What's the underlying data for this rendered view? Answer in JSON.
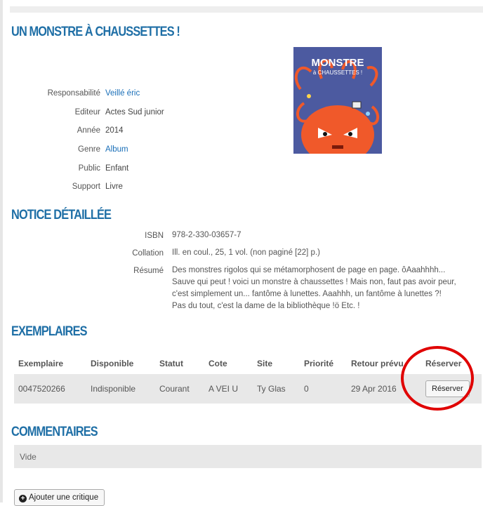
{
  "title": "UN MONSTRE À CHAUSSETTES !",
  "info": [
    {
      "label": "Responsabilité",
      "value": "Veillé éric",
      "link": true
    },
    {
      "label": "Editeur",
      "value": "Actes Sud junior",
      "link": false
    },
    {
      "label": "Année",
      "value": "2014",
      "link": false
    },
    {
      "label": "Genre",
      "value": "Album",
      "link": true
    },
    {
      "label": "Public",
      "value": "Enfant",
      "link": false
    },
    {
      "label": "Support",
      "value": "Livre",
      "link": false
    }
  ],
  "cover": {
    "line1": "MONSTRE",
    "line2": "à CHAUSSETTES !",
    "bg_color": "#4c5aa0",
    "monster_color": "#f0592a"
  },
  "details_heading": "NOTICE DÉTAILLÉE",
  "details": {
    "isbn_label": "ISBN",
    "isbn": "978-2-330-03657-7",
    "collation_label": "Collation",
    "collation": "Ill. en coul., 25, 1 vol. (non paginé [22] p.)",
    "resume_label": "Résumé",
    "resume_lines": [
      "Des monstres rigolos qui se métamorphosent de page en page. ôAaahhhh...",
      "Sauve qui peut ! voici un monstre à chaussettes ! Mais non, faut pas avoir peur,",
      "c'est simplement un... fantôme à lunettes. Aaahhh, un fantôme à lunettes ?!",
      "Pas du tout, c'est la dame de la bibliothèque !ö Etc. !"
    ]
  },
  "copies_heading": "EXEMPLAIRES",
  "copies": {
    "headers": [
      "Exemplaire",
      "Disponible",
      "Statut",
      "Cote",
      "Site",
      "Priorité",
      "Retour prévu",
      "Réserver"
    ],
    "row": [
      "0047520266",
      "Indisponible",
      "Courant",
      "A VEI U",
      "Ty Glas",
      "0",
      "29 Apr 2016"
    ],
    "reserve_button": "Réserver"
  },
  "comments_heading": "COMMENTAIRES",
  "comments_empty": "Vide",
  "add_review_button": "Ajouter une critique",
  "colors": {
    "heading": "#1f6fa6",
    "link": "#1a6fb8",
    "highlight_circle": "#e00000",
    "row_bg": "#e8e8e8"
  }
}
